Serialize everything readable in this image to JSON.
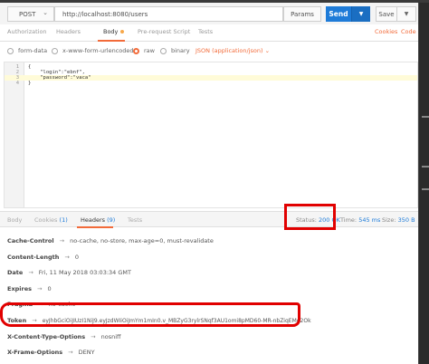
{
  "request": {
    "method": "POST",
    "url": "http://localhost:8080/users",
    "params_label": "Params",
    "send_label": "Send",
    "save_label": "Save"
  },
  "request_tabs": {
    "authorization": "Authorization",
    "headers": "Headers",
    "body": "Body",
    "pre_request": "Pre-request Script",
    "tests": "Tests",
    "cookies": "Cookies",
    "code": "Code"
  },
  "body_types": {
    "form_data": "form-data",
    "urlencoded": "x-www-form-urlencoded",
    "raw": "raw",
    "binary": "binary",
    "content_type": "JSON (application/json)",
    "selected": "raw"
  },
  "editor": {
    "lines": [
      {
        "num": "1",
        "text": "{"
      },
      {
        "num": "2",
        "text": "    \"login\":\"ebnf\","
      },
      {
        "num": "3",
        "text": "    \"password\":\"vaca\""
      },
      {
        "num": "4",
        "text": "}"
      }
    ]
  },
  "response": {
    "tabs": {
      "body": "Body",
      "cookies": "Cookies",
      "cookies_count": "(1)",
      "headers": "Headers",
      "headers_count": "(9)",
      "tests": "Tests"
    },
    "status_label": "Status:",
    "status_value": "200 OK",
    "time_label": "Time:",
    "time_value": "545 ms",
    "size_label": "Size:",
    "size_value": "350 B",
    "headers": [
      {
        "key": "Cache-Control",
        "value": "no-cache, no-store, max-age=0, must-revalidate"
      },
      {
        "key": "Content-Length",
        "value": "0"
      },
      {
        "key": "Date",
        "value": "Fri, 11 May 2018 03:03:34 GMT"
      },
      {
        "key": "Expires",
        "value": "0"
      },
      {
        "key": "Pragma",
        "value": "no-cache"
      },
      {
        "key": "Token",
        "value": "eyJhbGciOiJIUzI1NiJ9.eyJzdWIiOiJmYm1mIn0.v_MBZyG3rylrSNqf3AU1omi8pMD60-MR-nbZiqEMd2Ok"
      },
      {
        "key": "X-Content-Type-Options",
        "value": "nosniff"
      },
      {
        "key": "X-Frame-Options",
        "value": "DENY"
      }
    ],
    "arrow": "→"
  },
  "annotation_color": "#e10000",
  "accent_color": "#f26b3a",
  "send_color": "#1e7bd8"
}
